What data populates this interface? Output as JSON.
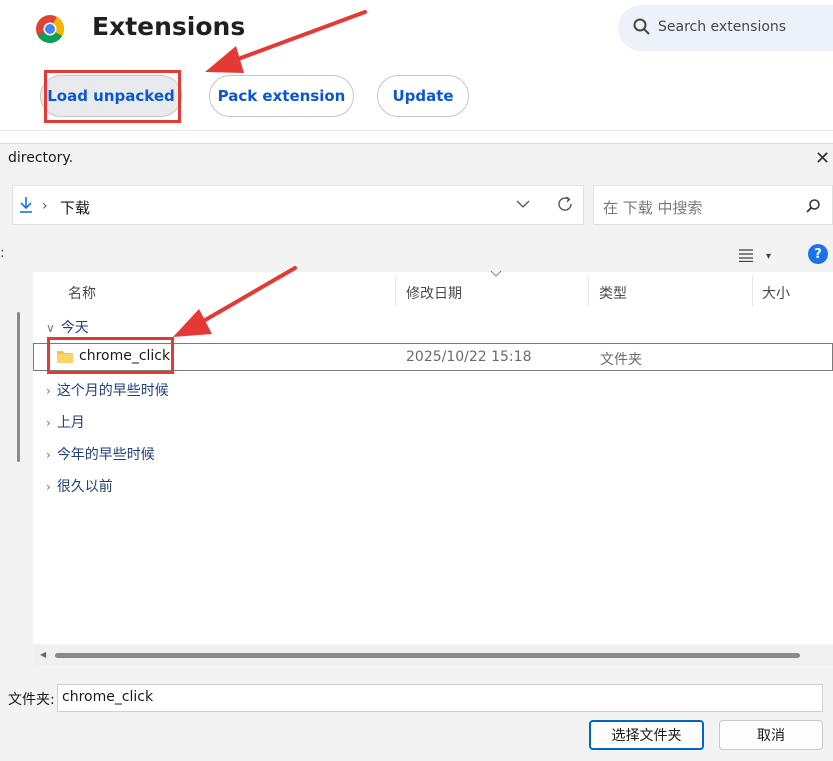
{
  "extensions": {
    "title": "Extensions",
    "search_placeholder": "Search extensions",
    "buttons": {
      "load_unpacked": "Load unpacked",
      "pack_extension": "Pack extension",
      "update": "Update"
    }
  },
  "dialog": {
    "title_fragment": "directory.",
    "close_glyph": "✕",
    "breadcrumb": {
      "separator": "›",
      "folder": "下载"
    },
    "search_placeholder": "在 下载 中搜索",
    "toolbar_left_glyph": ":",
    "help_glyph": "?",
    "view_dropdown_glyph": "▾",
    "columns": {
      "name": "名称",
      "date": "修改日期",
      "type": "类型",
      "size": "大小"
    },
    "groups": [
      {
        "label": "今天",
        "expanded": true
      },
      {
        "label": "这个月的早些时候",
        "expanded": false
      },
      {
        "label": "上月",
        "expanded": false
      },
      {
        "label": "今年的早些时候",
        "expanded": false
      },
      {
        "label": "很久以前",
        "expanded": false
      }
    ],
    "group_chevrons": {
      "expanded": "∨",
      "collapsed": "›"
    },
    "rows": [
      {
        "name": "chrome_click",
        "date": "2025/10/22 15:18",
        "type": "文件夹"
      }
    ],
    "scroll_left_glyph": "◀",
    "filename_label": "文件夹:",
    "filename_value": "chrome_click",
    "buttons": {
      "select": "选择文件夹",
      "cancel": "取消"
    }
  },
  "colors": {
    "annotation_red": "#e53935",
    "chrome_blue": "#0b57d0",
    "folder_yellow": "#f4c542",
    "help_blue": "#1a73e8"
  },
  "icons": [
    "chrome-logo-icon",
    "search-icon",
    "download-arrow-icon",
    "chevron-down-icon",
    "refresh-icon",
    "magnifier-icon",
    "list-view-icon",
    "help-icon",
    "folder-icon",
    "close-icon"
  ]
}
